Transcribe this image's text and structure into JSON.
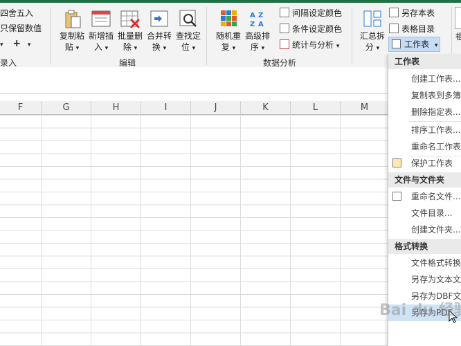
{
  "ribbon": {
    "left_items": [
      "四舍五入",
      "只保留数值",
      "+"
    ],
    "left_group": "录入",
    "edit_group": "编辑",
    "analysis_group": "数据分析",
    "buttons": {
      "copy_paste": [
        "复制粘",
        "贴"
      ],
      "new_insert": [
        "新增插",
        "入"
      ],
      "batch_delete": [
        "批量删",
        "除"
      ],
      "merge_convert": [
        "合并转",
        "换"
      ],
      "find_locate": [
        "查找定",
        "位"
      ],
      "random_repeat": [
        "随机重",
        "复"
      ],
      "advanced_sort": [
        "高级排",
        "序"
      ],
      "summary_split": [
        "汇总拆",
        "分"
      ]
    },
    "analysis_items": [
      "间隔设定颜色",
      "条件设定颜色",
      "统计与分析"
    ],
    "right_items": [
      "另存本表",
      "表格目录",
      "工作表"
    ],
    "far_right_label": "祖"
  },
  "columns": [
    "F",
    "G",
    "H",
    "I",
    "J",
    "K",
    "L",
    "M"
  ],
  "menu": {
    "sections": [
      {
        "header": "工作表",
        "items": [
          "创建工作表...",
          "复制表到多簿",
          "删除指定表...",
          "排序工作表...",
          "重命名工作表",
          "保护工作表"
        ]
      },
      {
        "header": "文件与文件夹",
        "items": [
          "重命名文件...",
          "文件目录...",
          "创建文件夹..."
        ]
      },
      {
        "header": "格式转换",
        "items": [
          "文件格式转换",
          "另存为文本文",
          "另存为DBF文件",
          "另存为PDF"
        ]
      }
    ]
  },
  "watermark": "Bai du 经验"
}
